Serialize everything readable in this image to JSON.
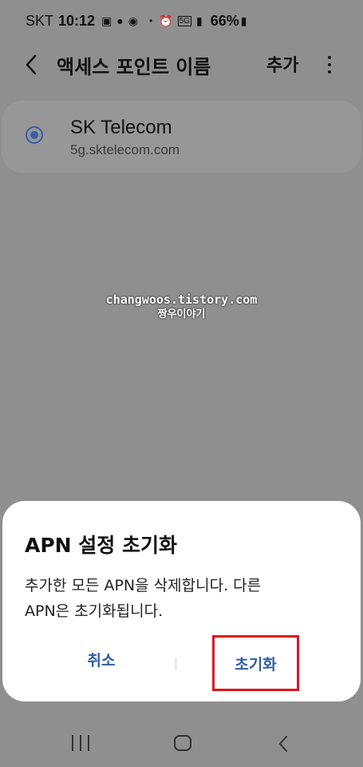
{
  "status_bar": {
    "carrier": "SKT",
    "time": "10:12",
    "network": "5G",
    "battery": "66%"
  },
  "app_bar": {
    "title": "액세스 포인트 이름",
    "add_label": "추가"
  },
  "apn_list": [
    {
      "name": "SK Telecom",
      "apn": "5g.sktelecom.com",
      "selected": true
    }
  ],
  "watermark": {
    "line1": "changwoos.tistory.com",
    "line2": "짱우이야기"
  },
  "dialog": {
    "title": "APN 설정 초기화",
    "body_line1": "추가한 모든 APN을 삭제합니다. 다른",
    "body_line2": "APN은 초기화됩니다.",
    "cancel_label": "취소",
    "confirm_label": "초기화"
  },
  "colors": {
    "accent": "#2d5fa8",
    "highlight_border": "#e0141d",
    "dim_background": "#8f8f8f"
  }
}
